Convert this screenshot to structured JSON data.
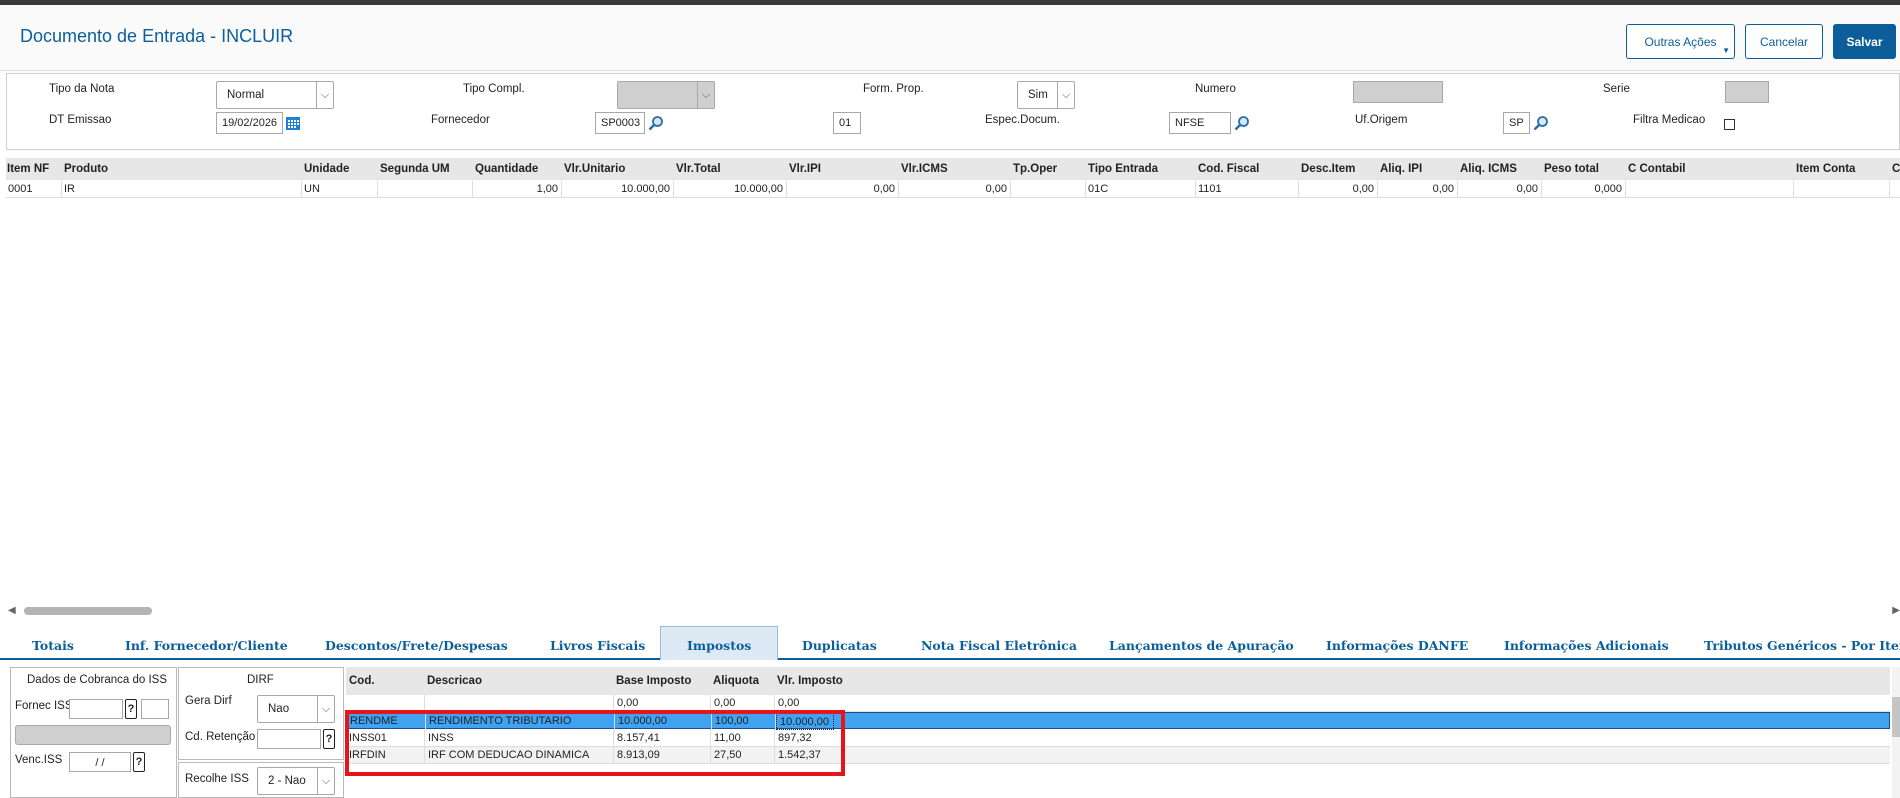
{
  "header": {
    "title": "Documento de Entrada - INCLUIR",
    "actions": {
      "outras": "Outras Ações",
      "cancelar": "Cancelar",
      "salvar": "Salvar"
    }
  },
  "form": {
    "tipo_nota": {
      "label": "Tipo da Nota",
      "value": "Normal"
    },
    "tipo_compl": {
      "label": "Tipo Compl.",
      "value": ""
    },
    "form_prop": {
      "label": "Form. Prop.",
      "value": "Sim"
    },
    "numero": {
      "label": "Numero",
      "value": ""
    },
    "serie": {
      "label": "Serie",
      "value": ""
    },
    "dt_emissao": {
      "label": "DT Emissao",
      "value": "19/02/2026"
    },
    "fornecedor": {
      "label": "Fornecedor",
      "value": "SP0003"
    },
    "loja": {
      "value": "01"
    },
    "espec_docum": {
      "label": "Espec.Docum.",
      "value": "NFSE"
    },
    "uf_origem": {
      "label": "Uf.Origem",
      "value": "SP"
    },
    "filtra_medicao": {
      "label": "Filtra Medicao"
    }
  },
  "items_grid": {
    "columns": [
      "Item NF",
      "Produto",
      "Unidade",
      "Segunda UM",
      "Quantidade",
      "Vlr.Unitario",
      "Vlr.Total",
      "Vlr.IPI",
      "Vlr.ICMS",
      "Tp.Oper",
      "Tipo Entrada",
      "Cod. Fiscal",
      "Desc.Item",
      "Aliq. IPI",
      "Aliq. ICMS",
      "Peso total",
      "C Contabil",
      "Item Conta",
      "C"
    ],
    "rows": [
      {
        "item": "0001",
        "produto": "IR",
        "unidade": "UN",
        "segunda_um": "",
        "quantidade": "1,00",
        "vlr_unitario": "10.000,00",
        "vlr_total": "10.000,00",
        "vlr_ipi": "0,00",
        "vlr_icms": "0,00",
        "tp_oper": "",
        "tipo_entrada": "01C",
        "cod_fiscal": "1101",
        "desc_item": "0,00",
        "aliq_ipi": "0,00",
        "aliq_icms": "0,00",
        "peso_total": "0,000",
        "c_contabil": "",
        "item_conta": ""
      }
    ]
  },
  "tabs": [
    "Totais",
    "Inf. Fornecedor/Cliente",
    "Descontos/Frete/Despesas",
    "Livros Fiscais",
    "Impostos",
    "Duplicatas",
    "Nota Fiscal Eletrônica",
    "Lançamentos de Apuração",
    "Informações DANFE",
    "Informações Adicionais",
    "Tributos Genéricos - Por Item"
  ],
  "active_tab": "Impostos",
  "iss_panel": {
    "title": "Dados de Cobranca do ISS",
    "fornec_label": "Fornec ISS",
    "venc_label": "Venc.ISS",
    "venc_value": "/ /",
    "help": "?"
  },
  "dirf_panel": {
    "title": "DIRF",
    "gera_label": "Gera Dirf",
    "gera_value": "Nao",
    "retencao_label": "Cd. Retenção",
    "recolhe_label": "Recolhe ISS",
    "recolhe_value": "2 - Nao"
  },
  "taxes": {
    "columns": [
      "Cod.",
      "Descricao",
      "Base Imposto",
      "Aliquota",
      "Vlr. Imposto"
    ],
    "totals_row": {
      "cod": "",
      "descricao": "",
      "base": "0,00",
      "aliquota": "0,00",
      "valor": "0,00"
    },
    "rows": [
      {
        "cod": "RENDME",
        "descricao": "RENDIMENTO TRIBUTARIO",
        "base": "10.000,00",
        "aliquota": "100,00",
        "valor": "10.000,00"
      },
      {
        "cod": "INSS01",
        "descricao": "INSS",
        "base": "8.157,41",
        "aliquota": "11,00",
        "valor": "897,32"
      },
      {
        "cod": "IRFDIN",
        "descricao": "IRF COM DEDUCAO DINAMICA",
        "base": "8.913,09",
        "aliquota": "27,50",
        "valor": "1.542,37"
      }
    ]
  },
  "colors": {
    "brand": "#0c5e9b",
    "selection": "#40a3f2",
    "highlight": "#e8141b"
  }
}
